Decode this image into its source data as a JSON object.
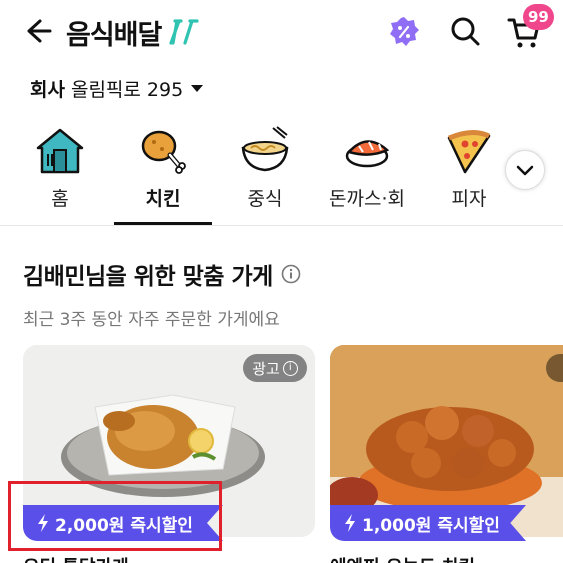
{
  "header": {
    "title": "음식배달",
    "cart_count": "99"
  },
  "address": {
    "label": "회사",
    "value": "올림픽로 295"
  },
  "categories": [
    {
      "label": "홈",
      "icon": "home-icon"
    },
    {
      "label": "치킨",
      "icon": "chicken-icon",
      "active": true
    },
    {
      "label": "중식",
      "icon": "noodle-bowl-icon"
    },
    {
      "label": "돈까스·회",
      "icon": "sushi-icon"
    },
    {
      "label": "피자",
      "icon": "pizza-icon"
    }
  ],
  "section": {
    "title": "김배민님을 위한 맞춤 가게",
    "subtitle": "최근 3주 동안 자주 주문한 가게에요"
  },
  "stores": [
    {
      "ad_label": "광고",
      "discount": "2,000원 즉시할인",
      "name": "오딘 통닭가게"
    },
    {
      "discount": "1,000원 즉시할인",
      "name": "에엔피 오늘도 치킨"
    }
  ],
  "colors": {
    "accent": "#5b4fe9",
    "badge": "#f0468c",
    "highlight_box": "#e0202a"
  }
}
